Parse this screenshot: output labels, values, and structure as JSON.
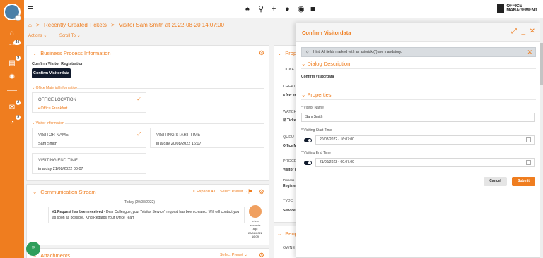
{
  "icons": {
    "sidebar": [
      "home-icon",
      "inbox-icon",
      "ticket-icon",
      "settings-icon",
      "chat-icon",
      "notifications-icon"
    ],
    "topbar": [
      "bell-icon",
      "search-icon",
      "plus-icon",
      "user-icon",
      "eye-icon",
      "lock-icon"
    ]
  },
  "sidebar": {
    "badges": {
      "inbox": "44",
      "ticket": "9",
      "chat": "2",
      "notifications": "3"
    }
  },
  "logo": {
    "line1": "OFFICE",
    "line2": "MANAGEMENT"
  },
  "breadcrumb": {
    "item1": "Recently Created Tickets",
    "sep": ">",
    "item2": "Visitor Sam Smith at 2022-08-20 14:07:00"
  },
  "actions": {
    "actions": "Actions ⌄",
    "scroll_to": "Scroll To ⌄"
  },
  "bpi": {
    "title": "Business Process Information",
    "confirm_label": "Confirm Visitor Registration",
    "confirm_button": "Confirm Visitordata",
    "office_section": "Office Material Information",
    "office_location_title": "OFFICE LOCATION",
    "office_location_value": "Office Frankfurt",
    "visitor_section": "Visitor Information",
    "visitor_name_title": "VISITOR NAME",
    "visitor_name_value": "Sam Smith",
    "visiting_start_title": "VISITING START TIME",
    "visiting_start_value": "in a day 20/08/2022 16:07",
    "visiting_end_title": "VISITING END TIME",
    "visiting_end_value": "in a day 21/08/2022 00:07"
  },
  "comm": {
    "title": "Communication Stream",
    "expand_all": "Expand All",
    "select_preset": "Select Preset ⌄",
    "date": "Today (20/08/2022)",
    "msg_title": "#1 Request has been received",
    "msg_body": " - Dear Colleague, your \"Visitor Service\" request has been created. Will will contact you as soon as possible. Kind Regards Your Office Team",
    "meta1": "a few",
    "meta2": "seconds",
    "meta3": "ago",
    "meta4": "20/08/2022",
    "meta5": "16:09"
  },
  "attachments": {
    "title": "Attachments",
    "select_preset": "Select Preset ⌄"
  },
  "right_column": {
    "title_partial": "Prop",
    "labels": [
      "TICKE",
      "CREAT",
      "WATCH",
      "QUEU",
      "PROCE",
      "TYPE"
    ],
    "values": [
      "a few se",
      "Ticke",
      "Office M",
      "Visitor R",
      "Service"
    ],
    "process_label": "Process",
    "process_value": "Registe",
    "people_title": "Peop",
    "owner_label": "OWNE"
  },
  "modal": {
    "title": "Confirm Visitordata",
    "hint": "Hint: All fields marked with an asterisk (*) are mandatory.",
    "dialog_section": "Dialog Description",
    "dialog_text": "Confirm Visitordata",
    "properties_section": "Properties",
    "visitor_name_label": "* Visitor Name",
    "visitor_name_value": "Sam Smith",
    "start_label": "* Visiting Start Time",
    "start_value": "20/08/2022 - 16:07:00",
    "end_label": "* Visiting End Time",
    "end_value": "21/08/2022 - 00:07:00",
    "cancel": "Cancel",
    "submit": "Submit"
  },
  "colors": {
    "accent": "#ef7d1f",
    "dark": "#101a2c",
    "chat": "#2e9e5b"
  }
}
